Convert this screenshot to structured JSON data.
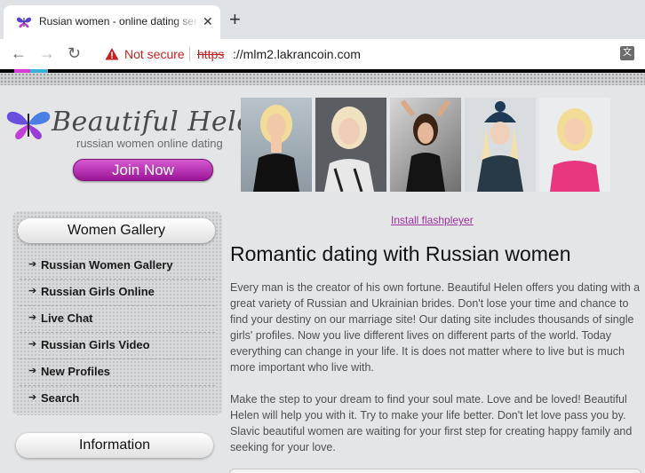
{
  "browser": {
    "tab_title": "Rusian women - online dating service",
    "close_glyph": "✕",
    "new_tab_glyph": "+",
    "back_glyph": "←",
    "forward_glyph": "→",
    "reload_glyph": "↻",
    "security_text": "Not secure",
    "url_scheme": "https",
    "url_rest": "://mlm2.lakrancoin.com",
    "translate_glyph": "文"
  },
  "site": {
    "logo_text": "Beautiful Helen",
    "tagline": "russian women online dating",
    "join_button": "Join Now",
    "photos": [
      "photo-1",
      "photo-2",
      "photo-3",
      "photo-4",
      "photo-5"
    ]
  },
  "sidebar": {
    "header": "Women Gallery",
    "arrow_glyph": "➔",
    "items": [
      {
        "label": "Russian Women Gallery"
      },
      {
        "label": "Russian Girls Online"
      },
      {
        "label": "Live Chat"
      },
      {
        "label": "Russian Girls Video"
      },
      {
        "label": "New Profiles"
      },
      {
        "label": "Search"
      }
    ],
    "info_header": "Information"
  },
  "main": {
    "flash_link": "Install flashpleyer",
    "title": "Romantic dating with Russian women",
    "paragraph1": "Every man is the creator of his own fortune. Beautiful Helen offers you dating with a great variety of Russian and Ukrainian brides. Don't lose your time and chance to find your destiny on our marriage site! Our dating site includes thousands of single girls' profiles. Now you live different lives on different parts of the world. Today everything can change in your life. It is does not matter where to live but is much more important who live with.",
    "paragraph2": "Make the step to your dream to find your soul mate. Love and be loved! Beautiful Helen will help you with it. Try to make your life better. Don't let love pass you by. Slavic beautiful women are waiting for your first step for creating happy family and seeking for your love."
  },
  "colors": {
    "accent_purple": "#a21c9f",
    "warning_red": "#c5221f",
    "link_purple": "#9b2fa0"
  }
}
